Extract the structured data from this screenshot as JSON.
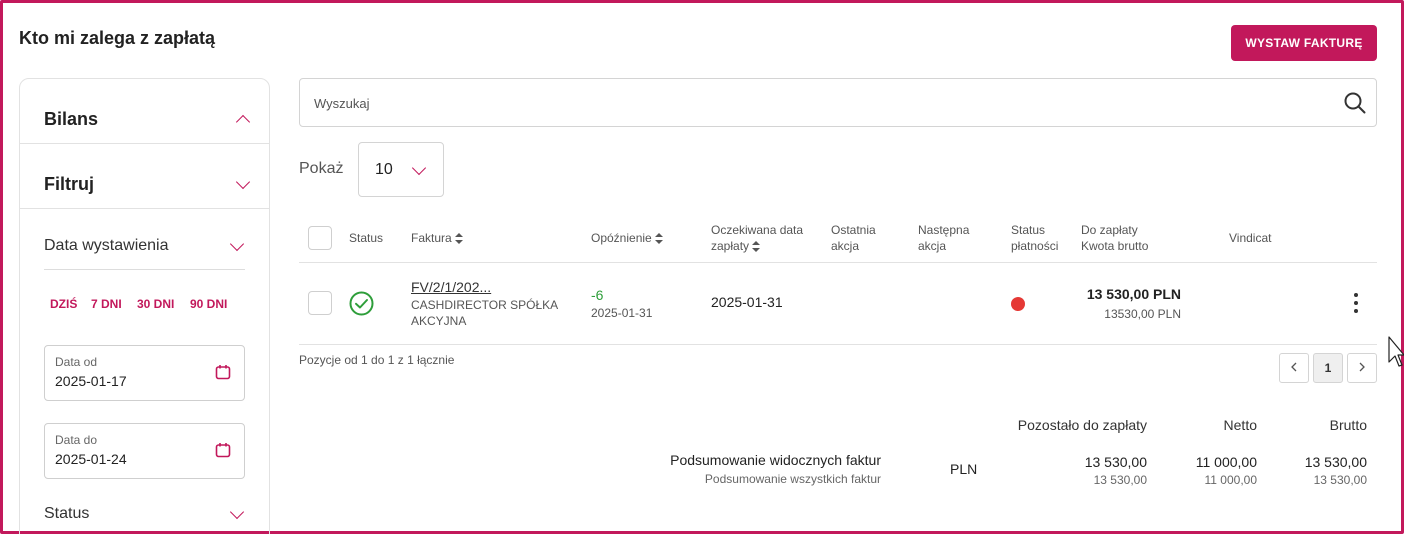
{
  "header": {
    "title": "Kto mi zalega z zapłatą",
    "issue_invoice_label": "WYSTAW FAKTURĘ",
    "accent_color": "#c2185b"
  },
  "sidebar": {
    "balance_label": "Bilans",
    "filter_label": "Filtruj",
    "issue_date_label": "Data wystawienia",
    "quick_ranges": [
      "DZIŚ",
      "7 DNI",
      "30 DNI",
      "90 DNI"
    ],
    "date_from": {
      "label": "Data od",
      "value": "2025-01-17"
    },
    "date_to": {
      "label": "Data do",
      "value": "2025-01-24"
    },
    "status_label": "Status"
  },
  "search": {
    "placeholder": "Wyszukaj"
  },
  "page_size": {
    "label": "Pokaż",
    "value": "10"
  },
  "table": {
    "headers": {
      "status": "Status",
      "invoice": "Faktura",
      "delay": "Opóźnienie",
      "expected_line1": "Oczekiwana data",
      "expected_line2": "zapłaty",
      "last_action_line1": "Ostatnia",
      "last_action_line2": "akcja",
      "next_action_line1": "Następna",
      "next_action_line2": "akcja",
      "payment_status_line1": "Status",
      "payment_status_line2": "płatności",
      "due_line1": "Do zapłaty",
      "due_line2": "Kwota brutto",
      "vindicat": "Vindicat"
    },
    "rows": [
      {
        "invoice_no": "FV/2/1/202...",
        "client_line1": "CASHDIRECTOR SPÓŁKA",
        "client_line2": "AKCYJNA",
        "delay_days": "-6",
        "delay_date": "2025-01-31",
        "expected_date": "2025-01-31",
        "amount_due": "13 530,00 PLN",
        "amount_gross": "13530,00 PLN",
        "payment_status_color": "#e53935",
        "status_icon": "check-circle-icon"
      }
    ]
  },
  "pagination": {
    "info": "Pozycje od 1 do 1 z 1 łącznie",
    "current_page": "1"
  },
  "summary": {
    "col_remaining": "Pozostało do zapłaty",
    "col_net": "Netto",
    "col_gross": "Brutto",
    "visible_label": "Podsumowanie widocznych faktur",
    "all_label": "Podsumowanie wszystkich faktur",
    "currency": "PLN",
    "visible_remaining": "13 530,00",
    "visible_net": "11 000,00",
    "visible_gross": "13 530,00",
    "all_remaining": "13 530,00",
    "all_net": "11 000,00",
    "all_gross": "13 530,00"
  }
}
